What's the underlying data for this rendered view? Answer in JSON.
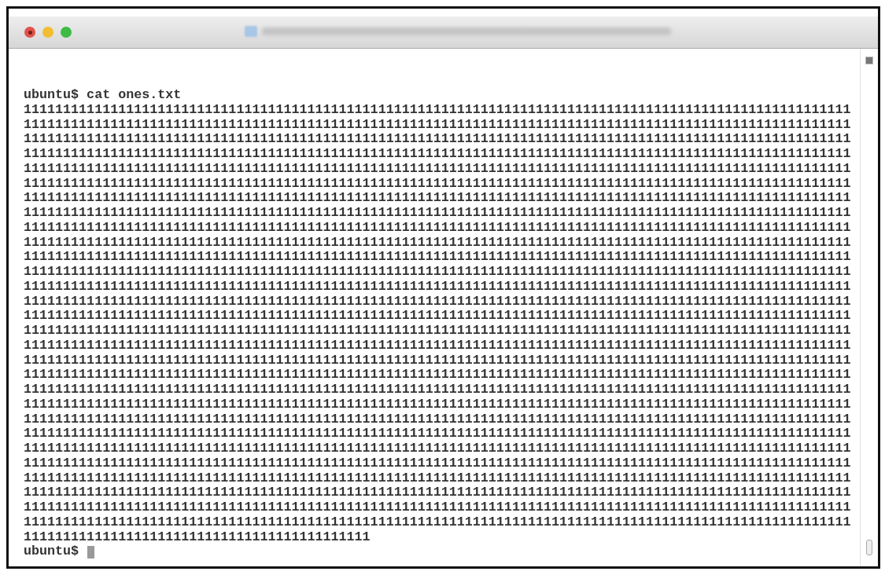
{
  "window": {
    "buttons": [
      {
        "kind": "close",
        "color": "#e0524b"
      },
      {
        "kind": "minimize",
        "color": "#f2bd2f"
      },
      {
        "kind": "zoom",
        "color": "#3dbb45"
      }
    ]
  },
  "terminal": {
    "command_line": "ubuntu$ cat ones.txt",
    "output": [
      "111111111111111111111111111111111111111111111111111111111111111111111111111111111111111111111111111111111",
      "111111111111111111111111111111111111111111111111111111111111111111111111111111111111111111111111111111111",
      "111111111111111111111111111111111111111111111111111111111111111111111111111111111111111111111111111111111",
      "111111111111111111111111111111111111111111111111111111111111111111111111111111111111111111111111111111111",
      "111111111111111111111111111111111111111111111111111111111111111111111111111111111111111111111111111111111",
      "111111111111111111111111111111111111111111111111111111111111111111111111111111111111111111111111111111111",
      "111111111111111111111111111111111111111111111111111111111111111111111111111111111111111111111111111111111",
      "111111111111111111111111111111111111111111111111111111111111111111111111111111111111111111111111111111111",
      "111111111111111111111111111111111111111111111111111111111111111111111111111111111111111111111111111111111",
      "111111111111111111111111111111111111111111111111111111111111111111111111111111111111111111111111111111111",
      "111111111111111111111111111111111111111111111111111111111111111111111111111111111111111111111111111111111",
      "111111111111111111111111111111111111111111111111111111111111111111111111111111111111111111111111111111111",
      "111111111111111111111111111111111111111111111111111111111111111111111111111111111111111111111111111111111",
      "111111111111111111111111111111111111111111111111111111111111111111111111111111111111111111111111111111111",
      "111111111111111111111111111111111111111111111111111111111111111111111111111111111111111111111111111111111",
      "111111111111111111111111111111111111111111111111111111111111111111111111111111111111111111111111111111111",
      "111111111111111111111111111111111111111111111111111111111111111111111111111111111111111111111111111111111",
      "111111111111111111111111111111111111111111111111111111111111111111111111111111111111111111111111111111111",
      "111111111111111111111111111111111111111111111111111111111111111111111111111111111111111111111111111111111",
      "111111111111111111111111111111111111111111111111111111111111111111111111111111111111111111111111111111111",
      "111111111111111111111111111111111111111111111111111111111111111111111111111111111111111111111111111111111",
      "111111111111111111111111111111111111111111111111111111111111111111111111111111111111111111111111111111111",
      "111111111111111111111111111111111111111111111111111111111111111111111111111111111111111111111111111111111",
      "111111111111111111111111111111111111111111111111111111111111111111111111111111111111111111111111111111111",
      "111111111111111111111111111111111111111111111111111111111111111111111111111111111111111111111111111111111",
      "111111111111111111111111111111111111111111111111111111111111111111111111111111111111111111111111111111111",
      "111111111111111111111111111111111111111111111111111111111111111111111111111111111111111111111111111111111",
      "111111111111111111111111111111111111111111111111111111111111111111111111111111111111111111111111111111111",
      "111111111111111111111111111111111111111111111111111111111111111111111111111111111111111111111111111111111",
      "11111111111111111111111111111111111111111111"
    ],
    "prompt": "ubuntu$"
  }
}
